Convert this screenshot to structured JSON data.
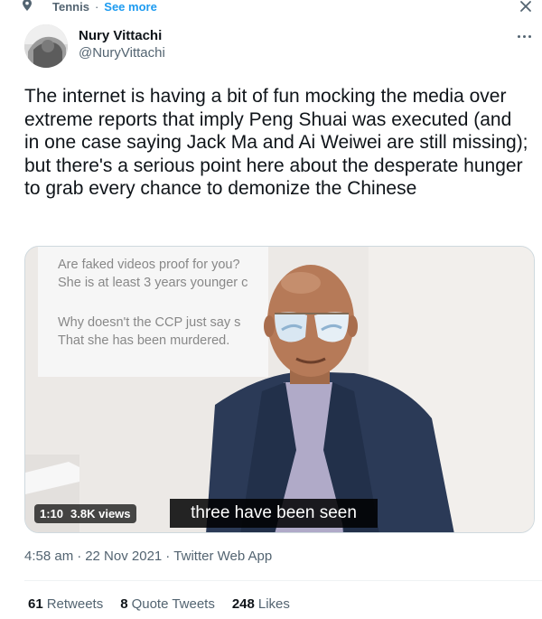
{
  "topic": {
    "icon": "topic-pin-icon",
    "label": "Tennis",
    "separator": "·",
    "see_more": "See more"
  },
  "author": {
    "name": "Nury Vittachi",
    "handle": "@NuryVittachi"
  },
  "tweet": {
    "text": "The internet is having a bit of fun mocking the media over extreme reports that imply Peng Shuai was executed (and in one case saying Jack Ma and Ai Weiwei are still missing); but there's a serious point here about the desperate hunger to grab every chance to demonize the Chinese"
  },
  "video": {
    "duration": "1:10",
    "views": "3.8K views",
    "subtitle": "three have been seen",
    "overlay_lines": [
      "Are faked videos proof for you?",
      "She is at least 3 years younger c",
      "Why doesn't the CCP just say s",
      "That she has been murdered."
    ]
  },
  "meta": {
    "time": "4:58 am",
    "separator": "·",
    "date": "22 Nov 2021",
    "app": "Twitter Web App"
  },
  "stats": {
    "retweets_count": "61",
    "retweets_label": "Retweets",
    "quotes_count": "8",
    "quotes_label": "Quote Tweets",
    "likes_count": "248",
    "likes_label": "Likes"
  },
  "colors": {
    "accent": "#1d9bf0",
    "secondary_text": "#536471",
    "primary_text": "#0f1419"
  }
}
